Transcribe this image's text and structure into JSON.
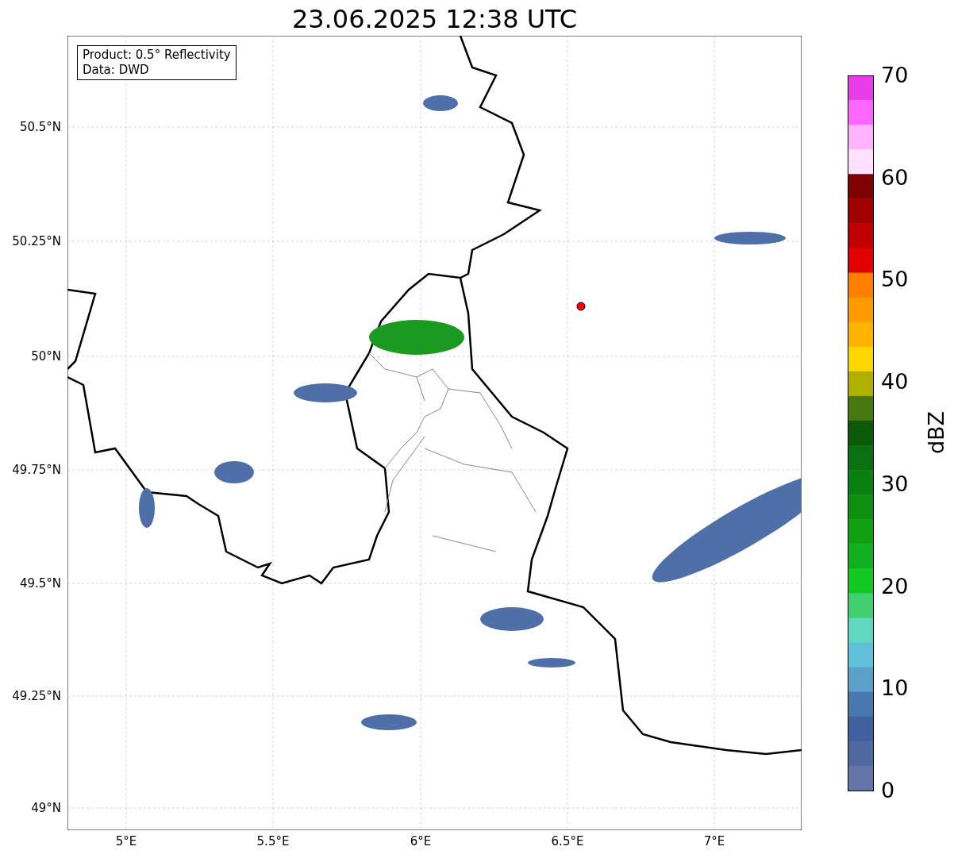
{
  "title": "23.06.2025 12:38 UTC",
  "legend": [
    "Product: 0.5° Reflectivity",
    "Data: DWD"
  ],
  "y_ticks": [
    "50.5°N",
    "50.25°N",
    "50°N",
    "49.75°N",
    "49.5°N",
    "49.25°N",
    "49°N"
  ],
  "x_ticks": [
    "5°E",
    "5.5°E",
    "6°E",
    "6.5°E",
    "7°E"
  ],
  "colorbar": {
    "label": "dBZ",
    "ticks": [
      "70",
      "60",
      "50",
      "40",
      "30",
      "20",
      "10",
      "0"
    ]
  }
}
